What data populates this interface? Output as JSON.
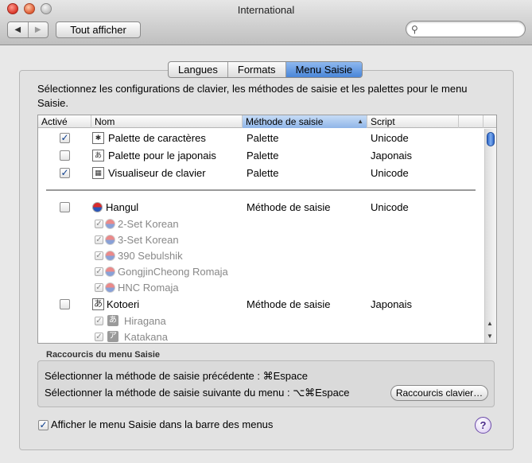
{
  "window": {
    "title": "International"
  },
  "toolbar": {
    "back_icon": "◀",
    "forward_icon": "▶",
    "show_all_label": "Tout afficher",
    "search_value": ""
  },
  "tabs": [
    {
      "label": "Langues",
      "active": false
    },
    {
      "label": "Formats",
      "active": false
    },
    {
      "label": "Menu Saisie",
      "active": true
    }
  ],
  "description": "Sélectionnez les configurations de clavier, les méthodes de saisie et les palettes pour le menu Saisie.",
  "table": {
    "headers": {
      "active": "Activé",
      "name": "Nom",
      "method": "Méthode de saisie",
      "script": "Script"
    },
    "sorted_column": "method",
    "sort_direction_icon": "▲",
    "rows_top": [
      {
        "checked": true,
        "icon": "character-palette-icon",
        "name": "Palette de caractères",
        "method": "Palette",
        "script": "Unicode"
      },
      {
        "checked": false,
        "icon": "japanese-palette-icon",
        "name": "Palette pour le japonais",
        "method": "Palette",
        "script": "Japonais"
      },
      {
        "checked": true,
        "icon": "keyboard-viewer-icon",
        "name": "Visualiseur de clavier",
        "method": "Palette",
        "script": "Unicode"
      }
    ],
    "hangul": {
      "checked": false,
      "name": "Hangul",
      "method": "Méthode de saisie",
      "script": "Unicode",
      "sub": [
        "2-Set Korean",
        "3-Set Korean",
        "390 Sebulshik",
        "GongjinCheong Romaja",
        "HNC Romaja"
      ]
    },
    "kotoeri": {
      "checked": false,
      "icon_glyph": "あ",
      "name": "Kotoeri",
      "method": "Méthode de saisie",
      "script": "Japonais",
      "sub": [
        {
          "glyph": "あ",
          "name": "Hiragana"
        },
        {
          "glyph": "ア",
          "name": "Katakana"
        }
      ]
    }
  },
  "shortcuts": {
    "title": "Raccourcis du menu Saisie",
    "previous": "Sélectionner la méthode de saisie précédente : ⌘Espace",
    "next": "Sélectionner la méthode de saisie suivante du menu : ⌥⌘Espace",
    "button": "Raccourcis clavier…"
  },
  "show_menu": {
    "checked": true,
    "label": "Afficher le menu Saisie dans la barre des menus"
  },
  "help_glyph": "?"
}
